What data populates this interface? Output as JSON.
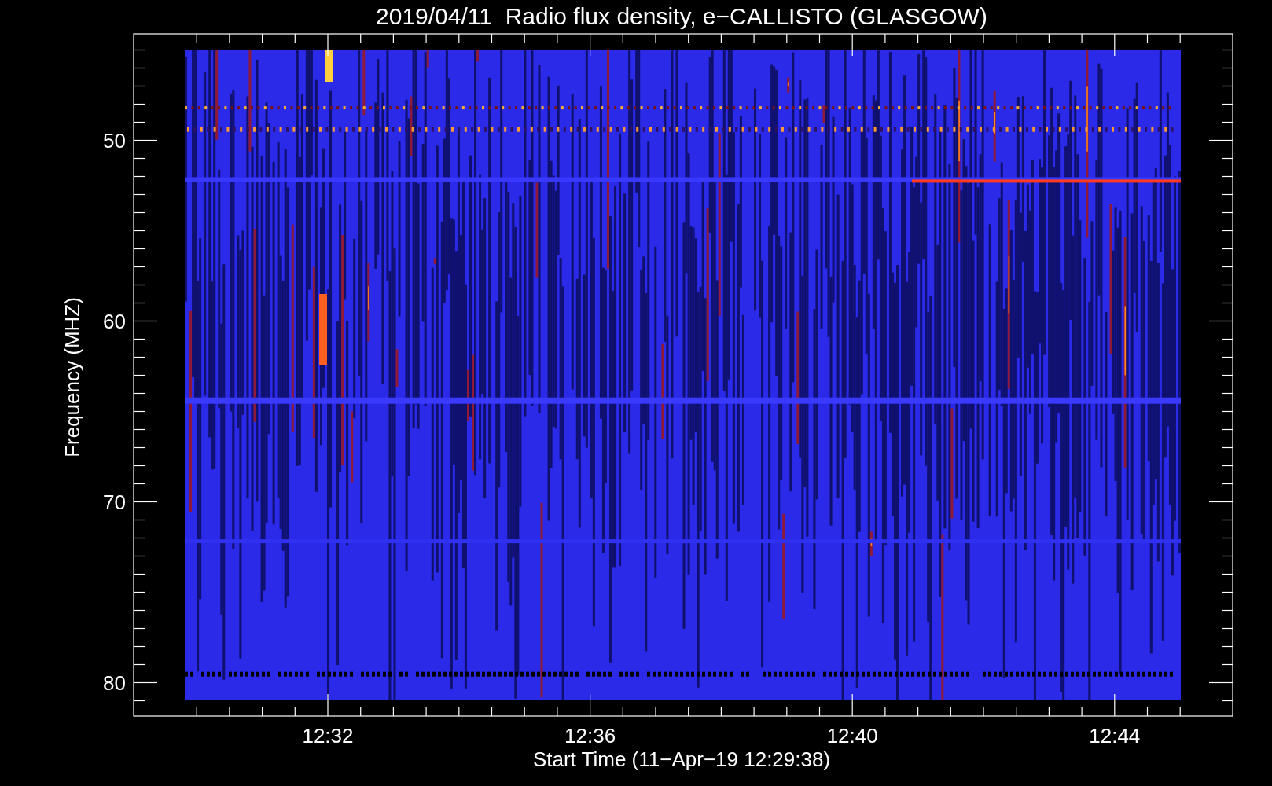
{
  "title": "2019/04/11  Radio flux density, e−CALLISTO (GLASGOW)",
  "y_axis": {
    "label": "Frequency (MHZ)",
    "ticks": [
      "50",
      "60",
      "70",
      "80"
    ]
  },
  "x_axis": {
    "label": "Start Time (11−Apr−19 12:29:38)",
    "ticks": [
      "12:32",
      "12:36",
      "12:40",
      "12:44"
    ]
  }
}
